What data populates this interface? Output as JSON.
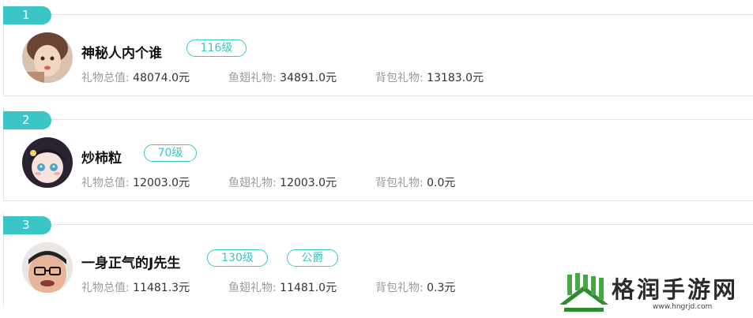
{
  "ranking": [
    {
      "rank": "1",
      "name": "神秘人内个谁",
      "badges": [
        "116级"
      ],
      "stats": [
        {
          "label": "礼物总值:",
          "value": "48074.0元"
        },
        {
          "label": "鱼翅礼物:",
          "value": "34891.0元"
        },
        {
          "label": "背包礼物:",
          "value": "13183.0元"
        }
      ]
    },
    {
      "rank": "2",
      "name": "炒柿粒",
      "badges": [
        "70级"
      ],
      "stats": [
        {
          "label": "礼物总值:",
          "value": "12003.0元"
        },
        {
          "label": "鱼翅礼物:",
          "value": "12003.0元"
        },
        {
          "label": "背包礼物:",
          "value": "0.0元"
        }
      ]
    },
    {
      "rank": "3",
      "name": "一身正气的J先生",
      "badges": [
        "130级",
        "公爵"
      ],
      "stats": [
        {
          "label": "礼物总值:",
          "value": "11481.3元"
        },
        {
          "label": "鱼翅礼物:",
          "value": "11481.0元"
        },
        {
          "label": "背包礼物:",
          "value": "0.3元"
        }
      ]
    }
  ],
  "watermark": {
    "text": "格润手游网",
    "url": "www.hngrjd.com"
  },
  "colors": {
    "accent": "#3ac6c6",
    "label": "#999999",
    "value": "#333333",
    "logo_green": "#2e8b2e"
  }
}
